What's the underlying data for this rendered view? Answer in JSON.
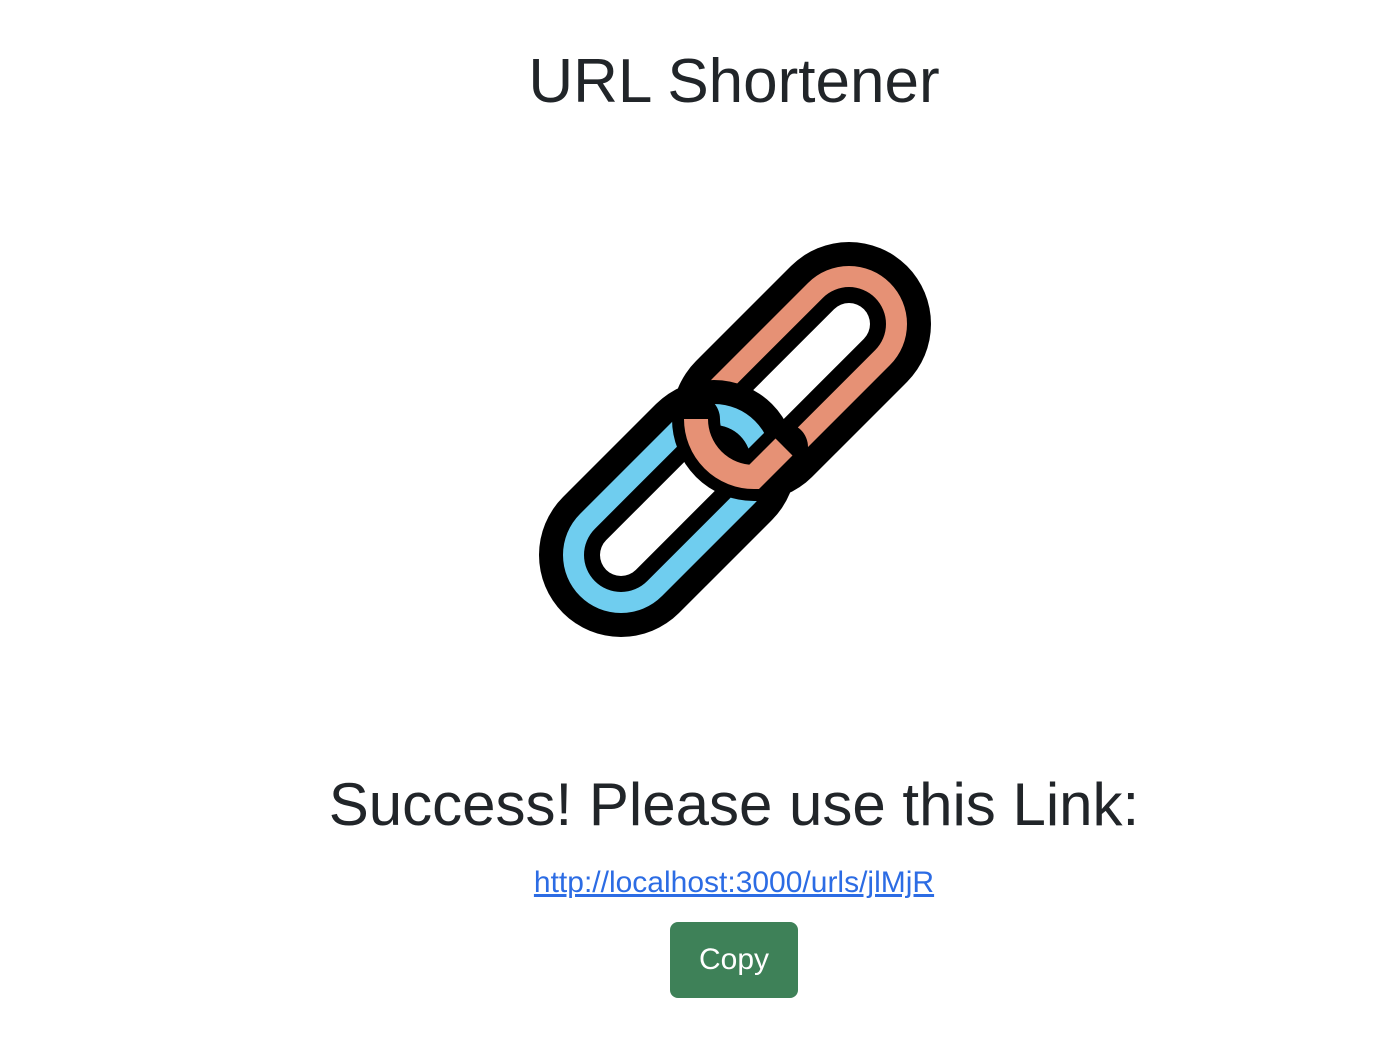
{
  "header": {
    "title": "URL Shortener"
  },
  "logo": {
    "icon": "chain-link-icon",
    "colors": {
      "left_link": "#6FCDEF",
      "right_link": "#E69175",
      "outline": "#000000"
    }
  },
  "result": {
    "heading": "Success! Please use this Link:",
    "short_url": "http://localhost:3000/urls/jlMjR"
  },
  "actions": {
    "copy_label": "Copy",
    "copy_color": "#3E8158"
  }
}
